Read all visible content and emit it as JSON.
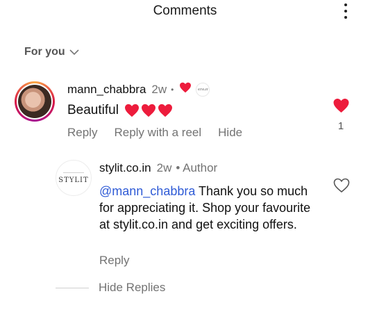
{
  "header": {
    "title": "Comments"
  },
  "sort": {
    "label": "For you"
  },
  "comment1": {
    "username": "mann_chabbra",
    "time": "2w",
    "separator": "•",
    "text": "Beautiful",
    "emoji_count": 3,
    "actions": {
      "reply": "Reply",
      "reply_reel": "Reply with a reel",
      "hide": "Hide"
    },
    "likes": "1",
    "liked": true,
    "author_liked_logo": "STYLIT"
  },
  "reply1": {
    "username": "stylit.co.in",
    "time": "2w",
    "author_label": "• Author",
    "avatar_logo": "STYLIT",
    "mention": "@mann_chabbra",
    "text": " Thank you so much for appreciating it. Shop your favourite at stylit.co.in and get exciting offers.",
    "actions": {
      "reply": "Reply"
    },
    "liked": false
  },
  "hide_replies": {
    "label": "Hide Replies"
  },
  "colors": {
    "heart": "#ed1c3c",
    "mention": "#2f5bd6",
    "muted": "#737373"
  }
}
